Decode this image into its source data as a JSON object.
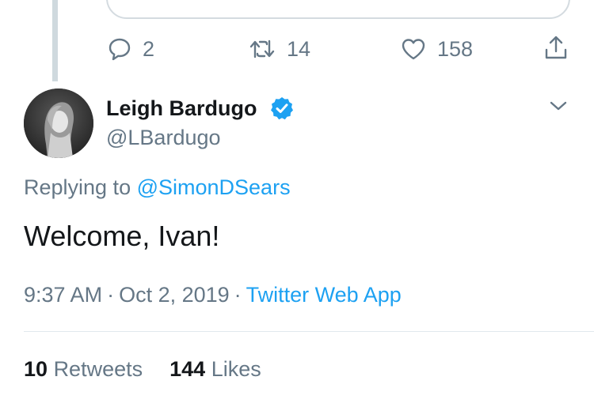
{
  "previous_tweet": {
    "actions": {
      "replies": "2",
      "retweets": "14",
      "likes": "158"
    }
  },
  "tweet": {
    "author_name": "Leigh Bardugo",
    "handle": "@LBardugo",
    "replying_prefix": "Replying to ",
    "replying_to": "@SimonDSears",
    "text": "Welcome, Ivan!",
    "time": "9:37 AM",
    "date": "Oct 2, 2019",
    "separator": "·",
    "source": "Twitter Web App",
    "stats": {
      "retweets_count": "10",
      "retweets_label": "Retweets",
      "likes_count": "144",
      "likes_label": "Likes"
    }
  },
  "colors": {
    "text_primary": "#14171a",
    "text_secondary": "#657786",
    "accent": "#1da1f2",
    "divider": "#e1e8ed",
    "thread_line": "#cfd9de"
  },
  "icons": {
    "reply": "speech-bubble-icon",
    "retweet": "retweet-arrows-icon",
    "like": "heart-outline-icon",
    "share": "share-upload-icon",
    "verified": "verified-badge-icon",
    "menu": "chevron-down-icon"
  }
}
